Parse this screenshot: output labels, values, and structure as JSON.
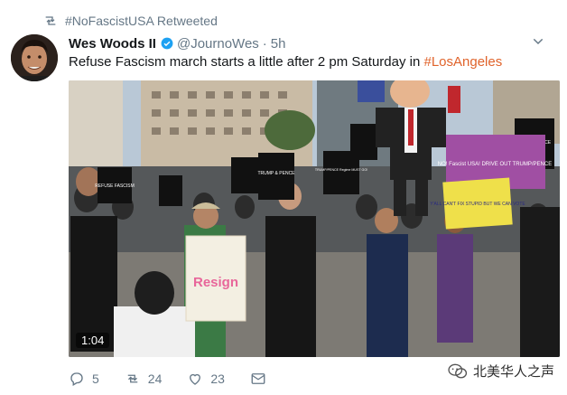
{
  "retweet": {
    "label": "#NoFascistUSA Retweeted"
  },
  "tweet": {
    "name": "Wes Woods II",
    "handle": "@JournoWes",
    "separator": "·",
    "time": "5h",
    "text_main": "Refuse Fascism march starts a little after 2 pm Saturday in ",
    "hashtag": "#LosAngeles"
  },
  "media": {
    "duration": "1:04",
    "signs": {
      "resign": "Resign",
      "sign_left_top": "REFUSE FASCISM",
      "sign_trump": "TRUMP & PENCE",
      "sign_pence": "TRUMP/PENCE Regime MUST GO!",
      "sign_right": "TRUMP PENCE",
      "banner": "NO! Fascist USA! DRIVE OUT TRUMP/PENCE",
      "yellow_sign": "Y'ALL CAN'T FIX STUPID BUT WE CAN VOTE"
    }
  },
  "actions": {
    "replies": "5",
    "retweets": "24",
    "likes": "23"
  },
  "watermark": {
    "label": "北美华人之声"
  },
  "colors": {
    "accent": "#e0632b",
    "verified": "#1da1f2",
    "muted": "#657786"
  }
}
